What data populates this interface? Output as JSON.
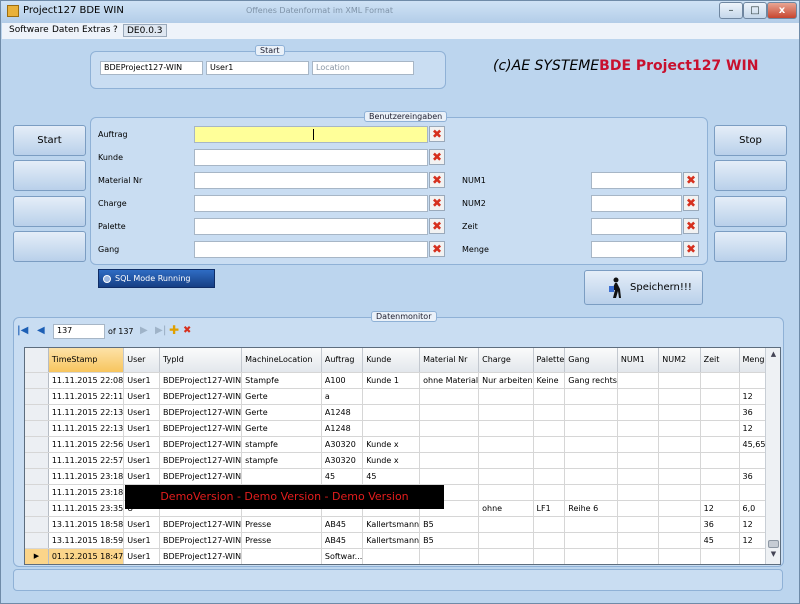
{
  "window": {
    "title": "Project127 BDE WIN",
    "ghost_title": "Offenes Datenformat im XML Format",
    "min": "–",
    "max": "□",
    "close": "x"
  },
  "menu": {
    "items": [
      "Software",
      "Daten",
      "Extras",
      "?"
    ],
    "version": "DE0.0.3"
  },
  "start_group": {
    "title": "Start",
    "field1": "BDEProject127-WIN",
    "field2": "User1",
    "location_placeholder": "Location"
  },
  "logo": {
    "prefix": "(c)AE SYSTEME",
    "product": "BDE Project127 WIN"
  },
  "side_buttons": {
    "start": "Start",
    "stop": "Stop"
  },
  "input_group": {
    "title": "Benutzereingaben",
    "left_labels": [
      "Auftrag",
      "Kunde",
      "Material Nr",
      "Charge",
      "Palette",
      "Gang"
    ],
    "right_labels": [
      "NUM1",
      "NUM2",
      "Zeit",
      "Menge"
    ],
    "clear_glyph": "✖"
  },
  "status": {
    "sql_mode": "SQL Mode Running"
  },
  "save_button": "Speichern!!!",
  "monitor": {
    "title": "Datenmonitor",
    "position": "137",
    "of_total": "of 137"
  },
  "grid": {
    "columns": [
      "TimeStamp",
      "User",
      "TypId",
      "MachineLocation",
      "Auftrag",
      "Kunde",
      "Material Nr",
      "Charge",
      "Palette",
      "Gang",
      "NUM1",
      "NUM2",
      "Zeit",
      "Menge"
    ],
    "rows": [
      [
        "11.11.2015 22:08",
        "User1",
        "BDEProject127-WIN",
        "Stampfe",
        "A100",
        "Kunde 1",
        "ohne Material",
        "Nur arbeiten",
        "Keine",
        "Gang rechts",
        "",
        "",
        "",
        ""
      ],
      [
        "11.11.2015 22:11",
        "User1",
        "BDEProject127-WIN",
        "Gerte",
        "a",
        "",
        "",
        "",
        "",
        "",
        "",
        "",
        "",
        "12"
      ],
      [
        "11.11.2015 22:13",
        "User1",
        "BDEProject127-WIN",
        "Gerte",
        "A1248",
        "",
        "",
        "",
        "",
        "",
        "",
        "",
        "",
        "36"
      ],
      [
        "11.11.2015 22:13",
        "User1",
        "BDEProject127-WIN",
        "Gerte",
        "A1248",
        "",
        "",
        "",
        "",
        "",
        "",
        "",
        "",
        "12"
      ],
      [
        "11.11.2015 22:56",
        "User1",
        "BDEProject127-WIN",
        "stampfe",
        "A30320",
        "Kunde x",
        "",
        "",
        "",
        "",
        "",
        "",
        "",
        "45,65"
      ],
      [
        "11.11.2015 22:57",
        "User1",
        "BDEProject127-WIN",
        "stampfe",
        "A30320",
        "Kunde x",
        "",
        "",
        "",
        "",
        "",
        "",
        "",
        ""
      ],
      [
        "11.11.2015 23:18",
        "User1",
        "BDEProject127-WIN",
        "",
        "45",
        "45",
        "",
        "",
        "",
        "",
        "",
        "",
        "",
        "36"
      ],
      [
        "11.11.2015 23:18",
        "U",
        "",
        "",
        "",
        "",
        "",
        "",
        "",
        "",
        "",
        "",
        "",
        ""
      ],
      [
        "11.11.2015 23:35",
        "U",
        "",
        "",
        "",
        "",
        "",
        "ohne",
        "LF1",
        "Reihe 6",
        "",
        "",
        "12",
        "6,0"
      ],
      [
        "13.11.2015 18:58",
        "User1",
        "BDEProject127-WIN",
        "Presse",
        "AB45",
        "Kallertsmann",
        "B5",
        "",
        "",
        "",
        "",
        "",
        "36",
        "12"
      ],
      [
        "13.11.2015 18:59",
        "User1",
        "BDEProject127-WIN",
        "Presse",
        "AB45",
        "Kallertsmann",
        "B5",
        "",
        "",
        "",
        "",
        "",
        "45",
        "12"
      ],
      [
        "01.12.2015 18:47",
        "User1",
        "BDEProject127-WIN",
        "",
        "Softwar...",
        "",
        "",
        "",
        "",
        "",
        "",
        "",
        "",
        ""
      ]
    ],
    "current_marker": "▶"
  },
  "demo_banner": "DemoVersion - Demo Version - Demo Version"
}
